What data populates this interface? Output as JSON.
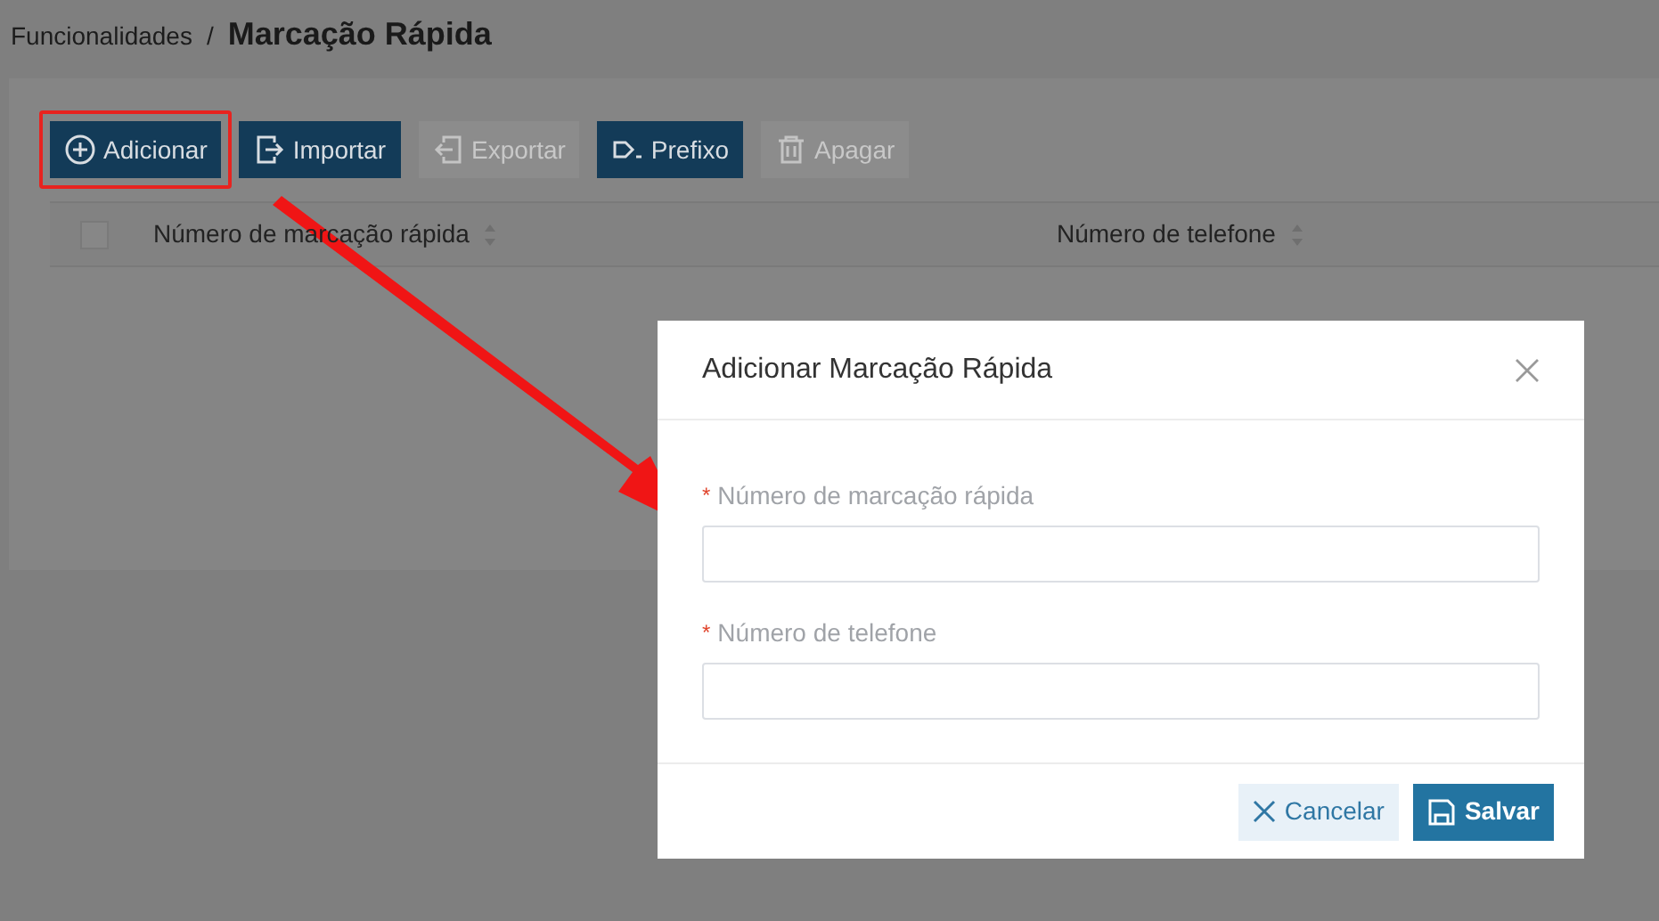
{
  "breadcrumb": {
    "parent": "Funcionalidades",
    "separator": "/",
    "current": "Marcação Rápida"
  },
  "toolbar": [
    {
      "label": "Adicionar",
      "kind": "plus",
      "disabled": false,
      "highlighted": true
    },
    {
      "label": "Importar",
      "kind": "import",
      "disabled": false,
      "highlighted": false
    },
    {
      "label": "Exportar",
      "kind": "export",
      "disabled": true,
      "highlighted": false
    },
    {
      "label": "Prefixo",
      "kind": "prefix",
      "disabled": false,
      "highlighted": false
    },
    {
      "label": "Apagar",
      "kind": "trash",
      "disabled": true,
      "highlighted": false
    }
  ],
  "table": {
    "select_all": {
      "checked": false
    },
    "columns": [
      {
        "label": "Número de marcação rápida"
      },
      {
        "label": "Número de telefone"
      }
    ]
  },
  "dialog": {
    "title": "Adicionar Marcação Rápida",
    "fields": [
      {
        "label": "Número de marcação rápida",
        "required_mark": "*"
      },
      {
        "label": "Número de telefone",
        "required_mark": "*"
      }
    ],
    "buttons": [
      {
        "label": "Cancelar",
        "kind": "secondary"
      },
      {
        "label": "Salvar",
        "kind": "primary"
      }
    ]
  }
}
